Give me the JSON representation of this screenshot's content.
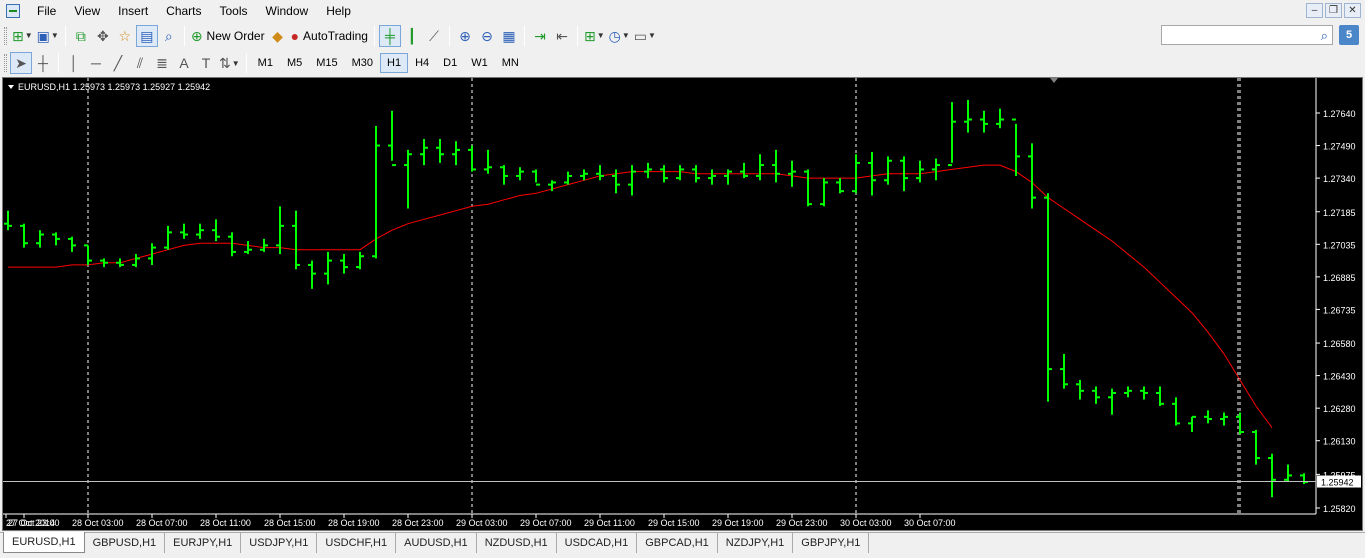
{
  "menu": [
    "File",
    "View",
    "Insert",
    "Charts",
    "Tools",
    "Window",
    "Help"
  ],
  "toolbar": {
    "new_order": "New Order",
    "auto_trading": "AutoTrading",
    "search_placeholder": "",
    "notification_count": "5"
  },
  "timeframes": [
    "M1",
    "M5",
    "M15",
    "M30",
    "H1",
    "H4",
    "D1",
    "W1",
    "MN"
  ],
  "active_timeframe": "H1",
  "chart_data": {
    "type": "ohlc",
    "symbol_header": "EURUSD,H1  1.25973 1.25973 1.25927 1.25942",
    "current_price": "1.25942",
    "colors": {
      "background": "#000000",
      "bars": "#00ff00",
      "ma": "#ff0000",
      "grid": "#ffffff",
      "axis_text": "#ffffff"
    },
    "y_ticks": [
      "1.27640",
      "1.27490",
      "1.27340",
      "1.27185",
      "1.27035",
      "1.26885",
      "1.26735",
      "1.26580",
      "1.26430",
      "1.26280",
      "1.26130",
      "1.25975",
      "1.25820"
    ],
    "y_tick_values": [
      1.2764,
      1.2749,
      1.2734,
      1.27185,
      1.27035,
      1.26885,
      1.26735,
      1.2658,
      1.2643,
      1.2628,
      1.2613,
      1.25975,
      1.2582
    ],
    "x_labels": [
      "27 Oct 2014",
      "27 Oct 23:00",
      "28 Oct 03:00",
      "28 Oct 07:00",
      "28 Oct 11:00",
      "28 Oct 15:00",
      "28 Oct 19:00",
      "28 Oct 23:00",
      "29 Oct 03:00",
      "29 Oct 07:00",
      "29 Oct 11:00",
      "29 Oct 15:00",
      "29 Oct 19:00",
      "29 Oct 23:00",
      "30 Oct 03:00",
      "30 Oct 07:00"
    ],
    "separator_bar_indices": [
      5,
      29,
      53,
      77
    ],
    "bars": [
      [
        1.2713,
        1.2719,
        1.271,
        1.2712
      ],
      [
        1.2712,
        1.2713,
        1.2702,
        1.2704
      ],
      [
        1.2704,
        1.271,
        1.2702,
        1.2708
      ],
      [
        1.2708,
        1.2709,
        1.2703,
        1.2706
      ],
      [
        1.2706,
        1.2707,
        1.27,
        1.2703
      ],
      [
        1.2703,
        1.2703,
        1.2694,
        1.2696
      ],
      [
        1.2696,
        1.2697,
        1.2693,
        1.2695
      ],
      [
        1.2695,
        1.2697,
        1.2693,
        1.2694
      ],
      [
        1.2694,
        1.2699,
        1.2693,
        1.2697
      ],
      [
        1.2697,
        1.2704,
        1.2694,
        1.2702
      ],
      [
        1.2702,
        1.2712,
        1.2701,
        1.2709
      ],
      [
        1.2709,
        1.2713,
        1.2706,
        1.2708
      ],
      [
        1.2708,
        1.2713,
        1.2706,
        1.271
      ],
      [
        1.271,
        1.2715,
        1.2705,
        1.2707
      ],
      [
        1.2707,
        1.2709,
        1.2698,
        1.27
      ],
      [
        1.27,
        1.2705,
        1.2699,
        1.2701
      ],
      [
        1.2701,
        1.2706,
        1.27,
        1.2703
      ],
      [
        1.2703,
        1.2721,
        1.2699,
        1.2712
      ],
      [
        1.2712,
        1.2719,
        1.2692,
        1.2694
      ],
      [
        1.2694,
        1.2696,
        1.2683,
        1.269
      ],
      [
        1.269,
        1.27,
        1.2685,
        1.2696
      ],
      [
        1.2696,
        1.2699,
        1.269,
        1.2693
      ],
      [
        1.2693,
        1.27,
        1.2692,
        1.2698
      ],
      [
        1.2698,
        1.2758,
        1.2697,
        1.2749
      ],
      [
        1.2749,
        1.2765,
        1.2742,
        1.274
      ],
      [
        1.274,
        1.2747,
        1.272,
        1.2745
      ],
      [
        1.2745,
        1.2752,
        1.274,
        1.2748
      ],
      [
        1.2748,
        1.2752,
        1.2741,
        1.2745
      ],
      [
        1.2745,
        1.2751,
        1.274,
        1.2747
      ],
      [
        1.2747,
        1.2749,
        1.2737,
        1.2738
      ],
      [
        1.2738,
        1.2747,
        1.2736,
        1.2739
      ],
      [
        1.2739,
        1.274,
        1.2731,
        1.2735
      ],
      [
        1.2735,
        1.2739,
        1.2733,
        1.2737
      ],
      [
        1.2737,
        1.2738,
        1.2732,
        1.2731
      ],
      [
        1.2731,
        1.2733,
        1.2728,
        1.2732
      ],
      [
        1.2732,
        1.2737,
        1.2731,
        1.2735
      ],
      [
        1.2735,
        1.2738,
        1.2733,
        1.2736
      ],
      [
        1.2736,
        1.274,
        1.2733,
        1.2735
      ],
      [
        1.2735,
        1.2738,
        1.2727,
        1.2731
      ],
      [
        1.2731,
        1.274,
        1.2726,
        1.2737
      ],
      [
        1.2737,
        1.2741,
        1.2734,
        1.2738
      ],
      [
        1.2738,
        1.274,
        1.2732,
        1.2734
      ],
      [
        1.2734,
        1.274,
        1.2733,
        1.2738
      ],
      [
        1.2738,
        1.274,
        1.2732,
        1.2734
      ],
      [
        1.2734,
        1.2738,
        1.2731,
        1.2735
      ],
      [
        1.2735,
        1.2738,
        1.2731,
        1.2737
      ],
      [
        1.2737,
        1.2741,
        1.2734,
        1.2735
      ],
      [
        1.2735,
        1.2745,
        1.2733,
        1.274
      ],
      [
        1.274,
        1.2747,
        1.2732,
        1.2736
      ],
      [
        1.2736,
        1.2742,
        1.273,
        1.2737
      ],
      [
        1.2737,
        1.2738,
        1.2721,
        1.2722
      ],
      [
        1.2722,
        1.2734,
        1.2721,
        1.2732
      ],
      [
        1.2732,
        1.2734,
        1.2727,
        1.2728
      ],
      [
        1.2728,
        1.2745,
        1.2727,
        1.2741
      ],
      [
        1.2741,
        1.2746,
        1.2726,
        1.2733
      ],
      [
        1.2733,
        1.2744,
        1.2731,
        1.2742
      ],
      [
        1.2742,
        1.2744,
        1.2728,
        1.2734
      ],
      [
        1.2734,
        1.2742,
        1.2732,
        1.2738
      ],
      [
        1.2738,
        1.2743,
        1.2733,
        1.274
      ],
      [
        1.274,
        1.2769,
        1.2741,
        1.276
      ],
      [
        1.276,
        1.277,
        1.2755,
        1.2761
      ],
      [
        1.2761,
        1.2765,
        1.2755,
        1.2759
      ],
      [
        1.2759,
        1.2766,
        1.2757,
        1.2761
      ],
      [
        1.2761,
        1.2759,
        1.2735,
        1.2744
      ],
      [
        1.2744,
        1.275,
        1.272,
        1.2725
      ],
      [
        1.2725,
        1.2727,
        1.2631,
        1.2646
      ],
      [
        1.2646,
        1.2653,
        1.2637,
        1.2639
      ],
      [
        1.2639,
        1.2641,
        1.2632,
        1.2636
      ],
      [
        1.2636,
        1.2638,
        1.263,
        1.2633
      ],
      [
        1.2633,
        1.2637,
        1.2625,
        1.2635
      ],
      [
        1.2635,
        1.2638,
        1.2633,
        1.2636
      ],
      [
        1.2636,
        1.2638,
        1.2632,
        1.2635
      ],
      [
        1.2635,
        1.2638,
        1.2629,
        1.263
      ],
      [
        1.263,
        1.2633,
        1.262,
        1.2621
      ],
      [
        1.2621,
        1.2624,
        1.2617,
        1.2624
      ],
      [
        1.2624,
        1.2627,
        1.2621,
        1.2623
      ],
      [
        1.2623,
        1.2626,
        1.262,
        1.2624
      ],
      [
        1.2624,
        1.2626,
        1.2616,
        1.2617
      ],
      [
        1.2617,
        1.2618,
        1.2602,
        1.2605
      ],
      [
        1.2605,
        1.2607,
        1.2587,
        1.2595
      ],
      [
        1.2595,
        1.2602,
        1.2594,
        1.2597
      ],
      [
        1.2597,
        1.2598,
        1.2593,
        1.2594
      ]
    ],
    "ma_values": [
      1.2693,
      1.2693,
      1.2693,
      1.2693,
      1.2694,
      1.2694,
      1.2695,
      1.2695,
      1.2697,
      1.2699,
      1.2701,
      1.2703,
      1.2704,
      1.2704,
      1.2704,
      1.2703,
      1.2702,
      1.2702,
      1.2701,
      1.2701,
      1.2701,
      1.2701,
      1.2701,
      1.2706,
      1.271,
      1.2713,
      1.2715,
      1.2717,
      1.2719,
      1.2721,
      1.2722,
      1.2724,
      1.2726,
      1.2727,
      1.2729,
      1.2731,
      1.2733,
      1.2735,
      1.2736,
      1.2737,
      1.2737,
      1.2737,
      1.2737,
      1.2736,
      1.2736,
      1.2736,
      1.2736,
      1.2736,
      1.2736,
      1.2735,
      1.2734,
      1.2734,
      1.2734,
      1.2734,
      1.2735,
      1.2736,
      1.2736,
      1.2736,
      1.2737,
      1.2738,
      1.2739,
      1.274,
      1.274,
      1.2737,
      1.2732,
      1.2725,
      1.272,
      1.2715,
      1.271,
      1.2705,
      1.2699,
      1.2693,
      1.2686,
      1.2679,
      1.2672,
      1.2663,
      1.2653,
      1.2641,
      1.2629,
      1.2619
    ]
  },
  "tabs": [
    "EURUSD,H1",
    "GBPUSD,H1",
    "EURJPY,H1",
    "USDJPY,H1",
    "USDCHF,H1",
    "AUDUSD,H1",
    "NZDUSD,H1",
    "USDCAD,H1",
    "GBPCAD,H1",
    "NZDJPY,H1",
    "GBPJPY,H1"
  ],
  "active_tab": "EURUSD,H1"
}
